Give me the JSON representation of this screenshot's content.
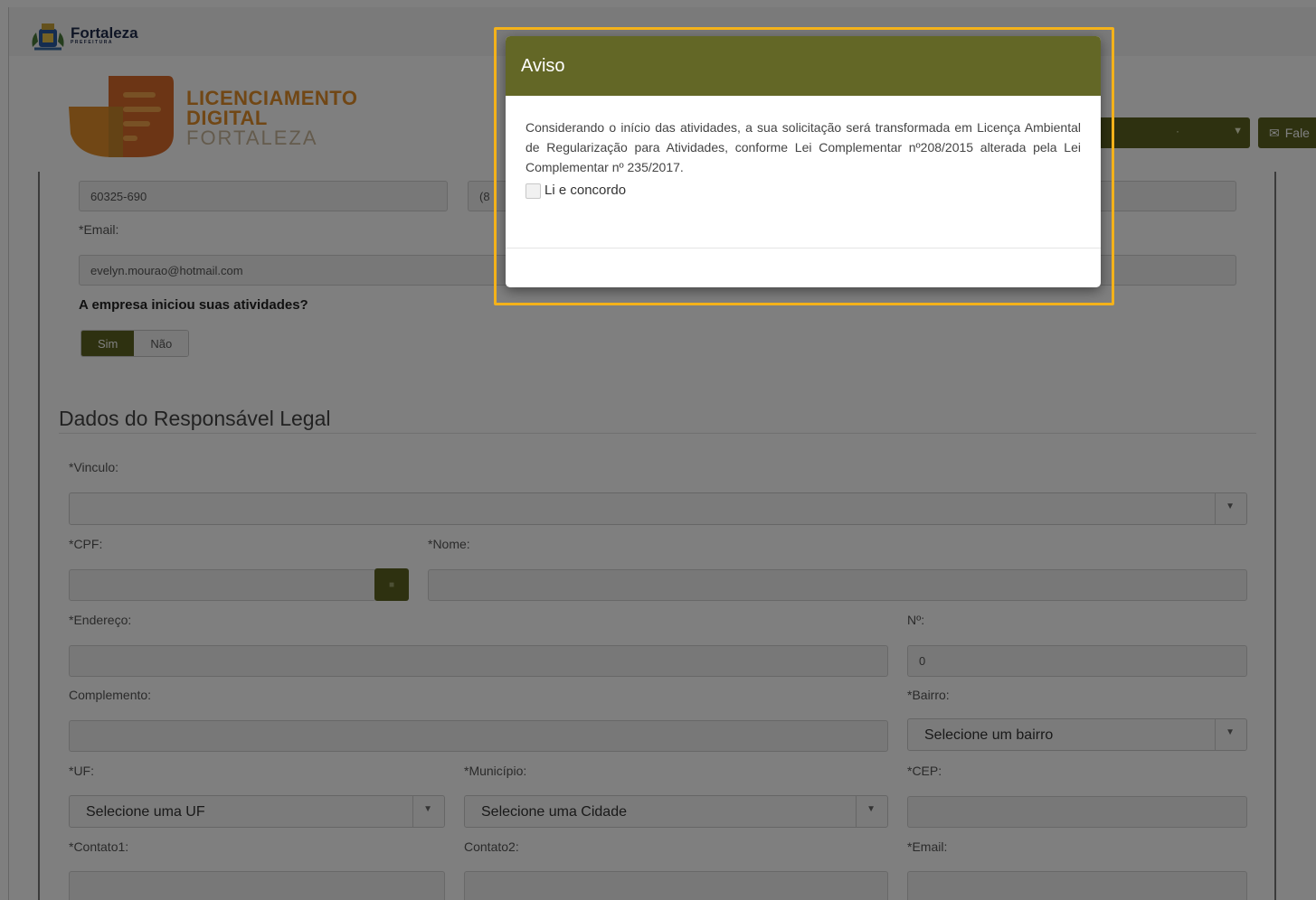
{
  "brand": {
    "name": "Fortaleza",
    "sub": "PREFEITURA"
  },
  "logo": {
    "line1": "LICENCIAMENTO",
    "line2": "DIGITAL",
    "line3": "FORTALEZA"
  },
  "header": {
    "select_value": "·",
    "contact_label": "Fale"
  },
  "company": {
    "cep_value": "60325-690",
    "phone_value": "(8",
    "email_label": "*Email:",
    "email_value": "evelyn.mourao@hotmail.com",
    "activity_question": "A empresa iniciou suas atividades?",
    "toggle": {
      "yes": "Sim",
      "no": "Não"
    }
  },
  "legal": {
    "title": "Dados do Responsável Legal",
    "vinculo_label": "*Vinculo:",
    "cpf_label": "*CPF:",
    "nome_label": "*Nome:",
    "endereco_label": "*Endereço:",
    "numero_label": "Nº:",
    "numero_value": "0",
    "complemento_label": "Complemento:",
    "bairro_label": "*Bairro:",
    "bairro_placeholder": "Selecione um bairro",
    "uf_label": "*UF:",
    "uf_placeholder": "Selecione uma UF",
    "municipio_label": "*Município:",
    "municipio_placeholder": "Selecione uma Cidade",
    "cep_label": "*CEP:",
    "contato1_label": "*Contato1:",
    "contato2_label": "Contato2:",
    "email_label": "*Email:"
  },
  "modal": {
    "title": "Aviso",
    "body": "Considerando o início das atividades, a sua solicitação será transformada em Licença Ambiental de Regularização para Atividades, conforme Lei Complementar nº208/2015 alterada pela Lei Complementar nº 235/2017.",
    "checkbox_label": "Li e concordo"
  },
  "colors": {
    "primary": "#5c6321",
    "modal_header": "#636726",
    "highlight": "#f4b21a",
    "logo_orange": "#e28f2a"
  }
}
